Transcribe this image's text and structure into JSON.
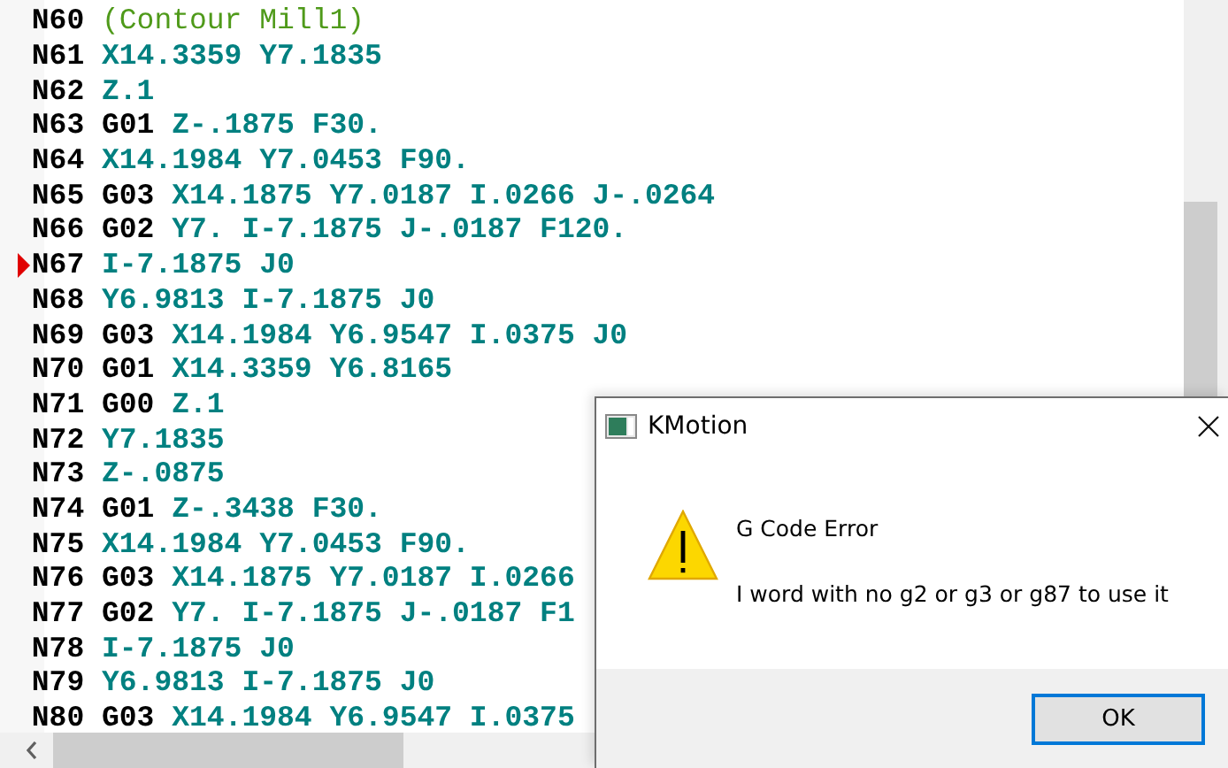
{
  "editor": {
    "lines": [
      {
        "number": "N60",
        "args": "(Contour Mill1)",
        "kind": "comment",
        "current": false
      },
      {
        "number": "N61",
        "args": "X14.3359 Y7.1835",
        "kind": "code",
        "current": false
      },
      {
        "number": "N62",
        "args": "Z.1",
        "kind": "code",
        "current": false
      },
      {
        "number": "N63",
        "gcode": "G01",
        "args": "Z-.1875 F30.",
        "kind": "code",
        "current": false
      },
      {
        "number": "N64",
        "args": "X14.1984 Y7.0453 F90.",
        "kind": "code",
        "current": false
      },
      {
        "number": "N65",
        "gcode": "G03",
        "args": "X14.1875 Y7.0187 I.0266 J-.0264",
        "kind": "code",
        "current": false
      },
      {
        "number": "N66",
        "gcode": "G02",
        "args": "Y7. I-7.1875 J-.0187 F120.",
        "kind": "code",
        "current": false
      },
      {
        "number": "N67",
        "args": "I-7.1875 J0",
        "kind": "code",
        "current": true
      },
      {
        "number": "N68",
        "args": "Y6.9813 I-7.1875 J0",
        "kind": "code",
        "current": false
      },
      {
        "number": "N69",
        "gcode": "G03",
        "args": "X14.1984 Y6.9547 I.0375 J0",
        "kind": "code",
        "current": false
      },
      {
        "number": "N70",
        "gcode": "G01",
        "args": "X14.3359 Y6.8165",
        "kind": "code",
        "current": false
      },
      {
        "number": "N71",
        "gcode": "G00",
        "args": "Z.1",
        "kind": "code",
        "current": false
      },
      {
        "number": "N72",
        "args": "Y7.1835",
        "kind": "code",
        "current": false
      },
      {
        "number": "N73",
        "args": "Z-.0875",
        "kind": "code",
        "current": false
      },
      {
        "number": "N74",
        "gcode": "G01",
        "args": "Z-.3438 F30.",
        "kind": "code",
        "current": false
      },
      {
        "number": "N75",
        "args": "X14.1984 Y7.0453 F90.",
        "kind": "code",
        "current": false
      },
      {
        "number": "N76",
        "gcode": "G03",
        "args": "X14.1875 Y7.0187 I.0266",
        "kind": "code",
        "current": false
      },
      {
        "number": "N77",
        "gcode": "G02",
        "args": "Y7. I-7.1875 J-.0187 F1",
        "kind": "code",
        "current": false
      },
      {
        "number": "N78",
        "args": "I-7.1875 J0",
        "kind": "code",
        "current": false
      },
      {
        "number": "N79",
        "args": "Y6.9813 I-7.1875 J0",
        "kind": "code",
        "current": false
      },
      {
        "number": "N80",
        "gcode": "G03",
        "args": "X14.1984 Y6.9547 I.0375",
        "kind": "code",
        "current": false
      }
    ]
  },
  "dialog": {
    "title": "KMotion",
    "heading": "G Code Error",
    "message": "I word with no g2 or g3 or g87 to use it",
    "buttons": [
      {
        "label": "OK",
        "focused": true
      }
    ]
  }
}
